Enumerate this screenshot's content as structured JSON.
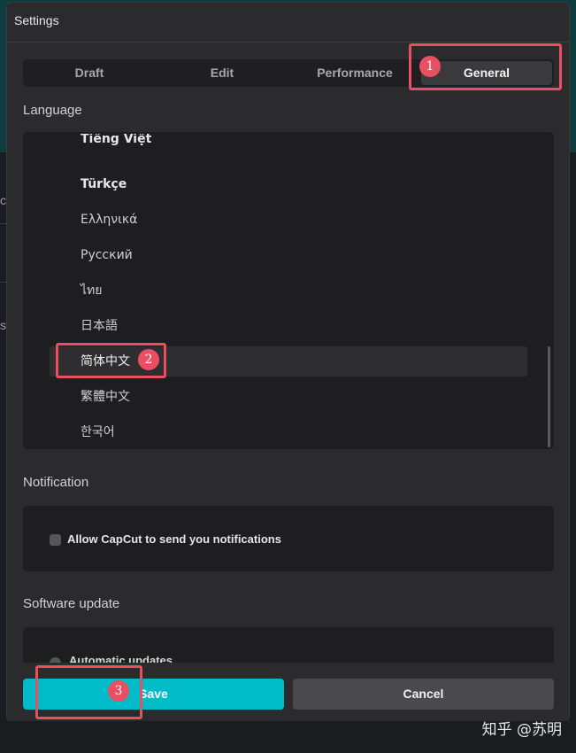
{
  "dialog": {
    "title": "Settings"
  },
  "tabs": [
    {
      "label": "Draft",
      "active": false
    },
    {
      "label": "Edit",
      "active": false
    },
    {
      "label": "Performance",
      "active": false
    },
    {
      "label": "General",
      "active": true
    }
  ],
  "language": {
    "label": "Language",
    "items": [
      {
        "label": "Tiếng Việt"
      },
      {
        "label": "Türkçe"
      },
      {
        "label": "Ελληνικά"
      },
      {
        "label": "Русский"
      },
      {
        "label": "ไทย"
      },
      {
        "label": "日本語"
      },
      {
        "label": "简体中文",
        "selected": true
      },
      {
        "label": "繁體中文"
      },
      {
        "label": "한국어"
      }
    ]
  },
  "notification": {
    "label": "Notification",
    "checkbox_label": "Allow CapCut to send you notifications",
    "checked": false
  },
  "software_update": {
    "label": "Software update",
    "option_label": "Automatic updates"
  },
  "buttons": {
    "save": "Save",
    "cancel": "Cancel"
  },
  "annotations": [
    "1",
    "2",
    "3"
  ],
  "background": {
    "edge_glyphs": [
      "c",
      "s"
    ]
  },
  "colors": {
    "accent": "#00bcc8",
    "annotation": "#e94f61"
  },
  "watermark": "知乎 @苏明"
}
